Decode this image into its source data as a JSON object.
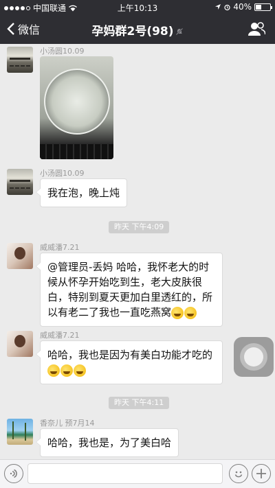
{
  "status_bar": {
    "carrier": "中国联通",
    "time": "上午10:13",
    "battery": "40%",
    "battery_level": 0.4
  },
  "nav": {
    "back_label": "微信",
    "title": "孕妈群2号(98)",
    "back_icon": "chevron-left-icon",
    "mute_icon": "bell-off-icon",
    "members_icon": "people-icon"
  },
  "messages": [
    {
      "sender": "小汤圆10.09",
      "type": "image",
      "avatar": "bridge"
    },
    {
      "sender": "小汤圆10.09",
      "type": "text",
      "text": "我在泡，晚上炖"
    },
    {
      "sender": "威威潘7.21",
      "type": "text",
      "text": "@管理员-丢妈 哈哈，我怀老大的时候从怀孕开始吃到生，老大皮肤很白，特别到夏天更加白里透红的，所以有老二了我也一直吃燕窝",
      "emojis": 2
    },
    {
      "sender": "威威潘7.21",
      "type": "text",
      "text": "哈哈，我也是因为有美白功能才吃的",
      "emojis": 3
    },
    {
      "sender": "香奈儿 预7月14",
      "type": "text",
      "text": "哈哈，我也是，为了美白哈"
    }
  ],
  "timestamps": [
    "昨天 下午4:09",
    "昨天 下午4:11"
  ],
  "input_bar": {
    "voice_icon": "voice-icon",
    "emoji_icon": "emoji-face-icon",
    "plus_icon": "plus-icon"
  },
  "colors": {
    "nav_bg": "#2e2e33",
    "chat_bg": "#ebebeb",
    "bubble_bg": "#ffffff",
    "time_pill_bg": "#cecece"
  }
}
